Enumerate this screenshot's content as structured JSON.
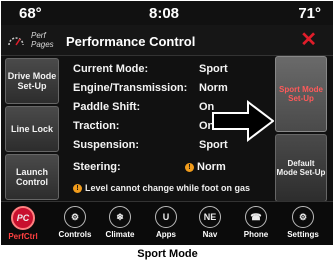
{
  "status": {
    "temp_left": "68°",
    "time": "8:08",
    "temp_right": "71°"
  },
  "header": {
    "perf_pages": "Perf Pages",
    "title": "Performance Control",
    "close_symbol": "✕"
  },
  "left_buttons": [
    {
      "label": "Drive Mode Set-Up"
    },
    {
      "label": "Line Lock"
    },
    {
      "label": "Launch Control"
    }
  ],
  "rows": [
    {
      "label": "Current Mode:",
      "value": "Sport"
    },
    {
      "label": "Engine/Transmission:",
      "value": "Norm"
    },
    {
      "label": "Paddle Shift:",
      "value": "On"
    },
    {
      "label": "Traction:",
      "value": "On"
    },
    {
      "label": "Suspension:",
      "value": "Sport"
    },
    {
      "label": "Steering:",
      "value": "Norm",
      "warning": true
    }
  ],
  "note": "Level cannot change while foot on gas",
  "right_buttons": [
    {
      "label": "Sport Mode Set-Up",
      "color": "#ff5a5a"
    },
    {
      "label": "Default Mode Set-Up"
    }
  ],
  "nav": [
    {
      "label": "PerfCtrl",
      "icon": "perf-control-icon",
      "glyph": "PC",
      "active": true
    },
    {
      "label": "Controls",
      "icon": "controls-icon",
      "glyph": "⚙"
    },
    {
      "label": "Climate",
      "icon": "climate-icon",
      "glyph": "❄"
    },
    {
      "label": "Apps",
      "icon": "apps-icon",
      "glyph": "U"
    },
    {
      "label": "Nav",
      "icon": "nav-icon",
      "glyph": "NE"
    },
    {
      "label": "Phone",
      "icon": "phone-icon",
      "glyph": "☎"
    },
    {
      "label": "Settings",
      "icon": "settings-icon",
      "glyph": "⚙"
    }
  ],
  "caption": "Sport Mode",
  "colors": {
    "accent_red": "#e01d2a",
    "warning_orange": "#f19c1c"
  }
}
